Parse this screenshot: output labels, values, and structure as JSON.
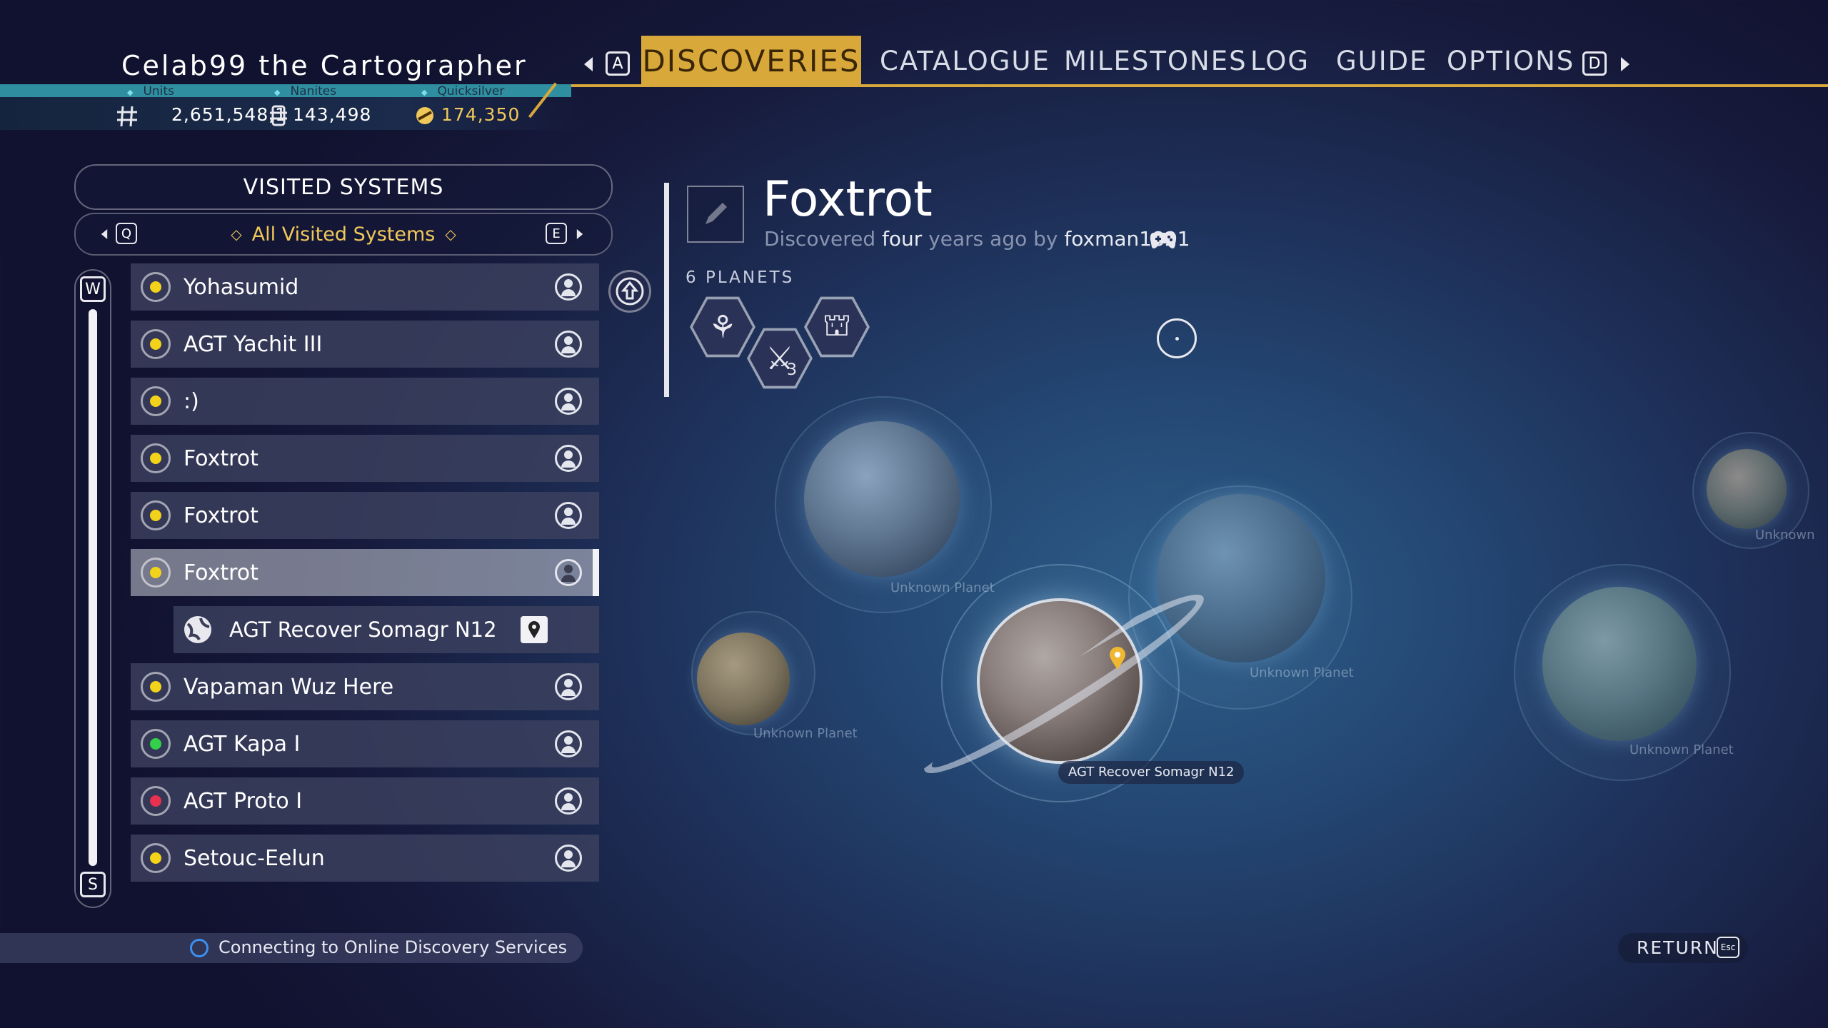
{
  "header": {
    "player_name": "Celab99 the Cartographer",
    "currencies": [
      {
        "label": "Units",
        "value": "2,651,548,1",
        "icon": "units-icon"
      },
      {
        "label": "Nanites",
        "value": "143,498",
        "icon": "nanites-icon"
      },
      {
        "label": "Quicksilver",
        "value": "174,350",
        "icon": "quicksilver-icon",
        "color": "#f0c85a"
      }
    ],
    "tabs": [
      "DISCOVERIES",
      "CATALOGUE",
      "MILESTONES",
      "LOG",
      "GUIDE",
      "OPTIONS"
    ],
    "active_tab": "DISCOVERIES",
    "prev_key": "A",
    "next_key": "D"
  },
  "left_panel": {
    "title": "VISITED SYSTEMS",
    "filter_label": "All Visited Systems",
    "filter_prev_key": "Q",
    "filter_next_key": "E",
    "scroll_up_key": "W",
    "scroll_down_key": "S",
    "systems": [
      {
        "name": "Yohasumid",
        "star_color": "#f3d21a"
      },
      {
        "name": "AGT Yachit III",
        "star_color": "#f3d21a"
      },
      {
        "name": ":)",
        "star_color": "#f3d21a"
      },
      {
        "name": "Foxtrot",
        "star_color": "#f3d21a"
      },
      {
        "name": "Foxtrot",
        "star_color": "#f3d21a"
      },
      {
        "name": "Foxtrot",
        "star_color": "#f3d21a",
        "selected": true
      },
      {
        "name": "Vapaman Wuz Here",
        "star_color": "#f3d21a"
      },
      {
        "name": "AGT Kapa I",
        "star_color": "#33d04a"
      },
      {
        "name": "AGT Proto I",
        "star_color": "#e83050"
      },
      {
        "name": "Setouc-Eelun",
        "star_color": "#f3d21a"
      }
    ],
    "selected_child": {
      "name": "AGT Recover Somagr N12"
    },
    "status_text": "Connecting to Online Discovery Services"
  },
  "detail": {
    "system_name": "Foxtrot",
    "disc_prefix": "Discovered",
    "disc_time_value": "four",
    "disc_time_suffix": "years ago by",
    "discoverer": "foxman1821",
    "planet_count": "6 PLANETS",
    "badge_count": "3",
    "planets": [
      {
        "label": "Unknown Planet"
      },
      {
        "label": "Unknown Planet"
      },
      {
        "label": "Unknown Planet"
      },
      {
        "label": "Unknown Planet"
      },
      {
        "label": "Unknown"
      },
      {
        "label": "AGT Recover Somagr N12"
      }
    ]
  },
  "footer": {
    "return_label": "RETURN",
    "return_key": "Esc"
  },
  "colors": {
    "accent": "#d8a93a",
    "selected_row": "#c8ccd6"
  }
}
